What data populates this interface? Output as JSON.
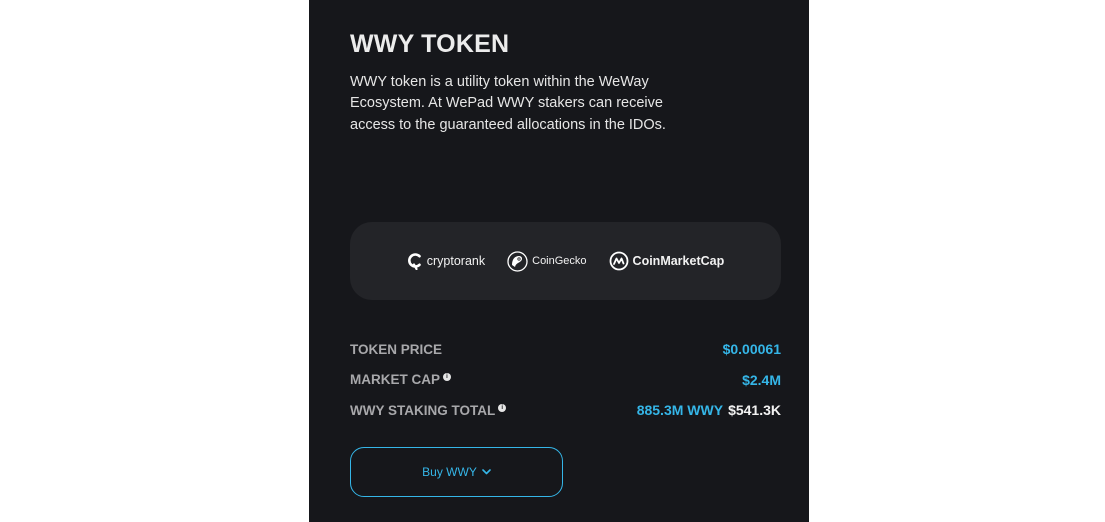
{
  "token": {
    "title": "WWY TOKEN",
    "description": "WWY token is a utility token within the WeWay Ecosystem. At WePad WWY stakers can receive access to the guaranteed allocations in the IDOs."
  },
  "partners": [
    {
      "name": "cryptorank",
      "icon": "cryptorank-logo-icon"
    },
    {
      "name": "CoinGecko",
      "icon": "coingecko-logo-icon"
    },
    {
      "name": "CoinMarketCap",
      "icon": "coinmarketcap-logo-icon"
    }
  ],
  "stats": {
    "token_price_label": "TOKEN PRICE",
    "token_price_value": "$0.00061",
    "market_cap_label": "MARKET CAP",
    "market_cap_value": "$2.4M",
    "staking_total_label": "WWY STAKING TOTAL",
    "staking_total_wwy": "885.3M WWY",
    "staking_total_usd": "$541.3K",
    "info_icon": "info-icon"
  },
  "buy": {
    "label": "Buy WWY",
    "icon": "chevron-down-icon"
  },
  "colors": {
    "panel_bg": "#16171b",
    "card_bg": "#232428",
    "accent": "#35b6e8",
    "label": "#a8a8ab",
    "text": "#ececec"
  }
}
